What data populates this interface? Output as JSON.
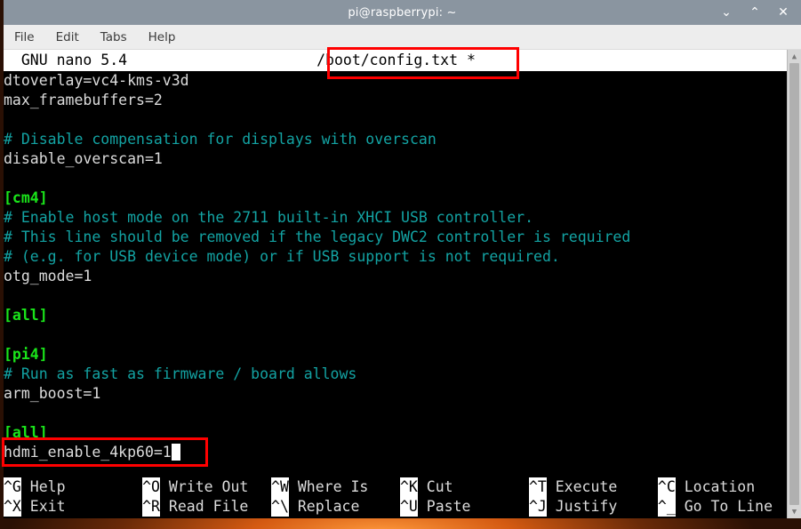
{
  "window": {
    "title": "pi@raspberrypi: ~",
    "controls": [
      {
        "name": "minimize",
        "glyph": "⌄"
      },
      {
        "name": "maximize",
        "glyph": "⌃"
      },
      {
        "name": "close",
        "glyph": "✕"
      }
    ]
  },
  "menubar": {
    "items": [
      "File",
      "Edit",
      "Tabs",
      "Help"
    ]
  },
  "nano": {
    "version_label": "  GNU nano 5.4",
    "filename": "/boot/config.txt *",
    "lines": [
      {
        "text": "dtoverlay=vc4-kms-v3d",
        "style": "plain"
      },
      {
        "text": "max_framebuffers=2",
        "style": "plain"
      },
      {
        "text": "",
        "style": "plain"
      },
      {
        "text": "# Disable compensation for displays with overscan",
        "style": "comment"
      },
      {
        "text": "disable_overscan=1",
        "style": "plain"
      },
      {
        "text": "",
        "style": "plain"
      },
      {
        "text": "[cm4]",
        "style": "section"
      },
      {
        "text": "# Enable host mode on the 2711 built-in XHCI USB controller.",
        "style": "comment"
      },
      {
        "text": "# This line should be removed if the legacy DWC2 controller is required",
        "style": "comment"
      },
      {
        "text": "# (e.g. for USB device mode) or if USB support is not required.",
        "style": "comment"
      },
      {
        "text": "otg_mode=1",
        "style": "plain"
      },
      {
        "text": "",
        "style": "plain"
      },
      {
        "text": "[all]",
        "style": "section"
      },
      {
        "text": "",
        "style": "plain"
      },
      {
        "text": "[pi4]",
        "style": "section"
      },
      {
        "text": "# Run as fast as firmware / board allows",
        "style": "comment"
      },
      {
        "text": "arm_boost=1",
        "style": "plain"
      },
      {
        "text": "",
        "style": "plain"
      },
      {
        "text": "[all]",
        "style": "section"
      },
      {
        "text": "hdmi_enable_4kp60=1",
        "style": "plain",
        "cursor": true
      }
    ],
    "shortcuts": [
      [
        {
          "key": "^G",
          "label": " Help"
        },
        {
          "key": "^O",
          "label": " Write Out"
        },
        {
          "key": "^W",
          "label": " Where Is"
        },
        {
          "key": "^K",
          "label": " Cut"
        },
        {
          "key": "^T",
          "label": " Execute"
        },
        {
          "key": "^C",
          "label": " Location"
        }
      ],
      [
        {
          "key": "^X",
          "label": " Exit"
        },
        {
          "key": "^R",
          "label": " Read File"
        },
        {
          "key": "^\\",
          "label": " Replace"
        },
        {
          "key": "^U",
          "label": " Paste"
        },
        {
          "key": "^J",
          "label": " Justify"
        },
        {
          "key": "^_",
          "label": " Go To Line"
        }
      ]
    ]
  },
  "scrollbar": {
    "up_arrow": "▲",
    "down_arrow": "▼"
  },
  "annotations": [
    {
      "name": "filename-highlight",
      "color": "#ff0000"
    },
    {
      "name": "hdmi-line-highlight",
      "color": "#ff0000"
    }
  ],
  "colors": {
    "comment": "#13a3a3",
    "section": "#1ae41a",
    "plain": "#dcdcdc",
    "annotation": "#ff0000",
    "titlebar": "#8a95a0"
  }
}
